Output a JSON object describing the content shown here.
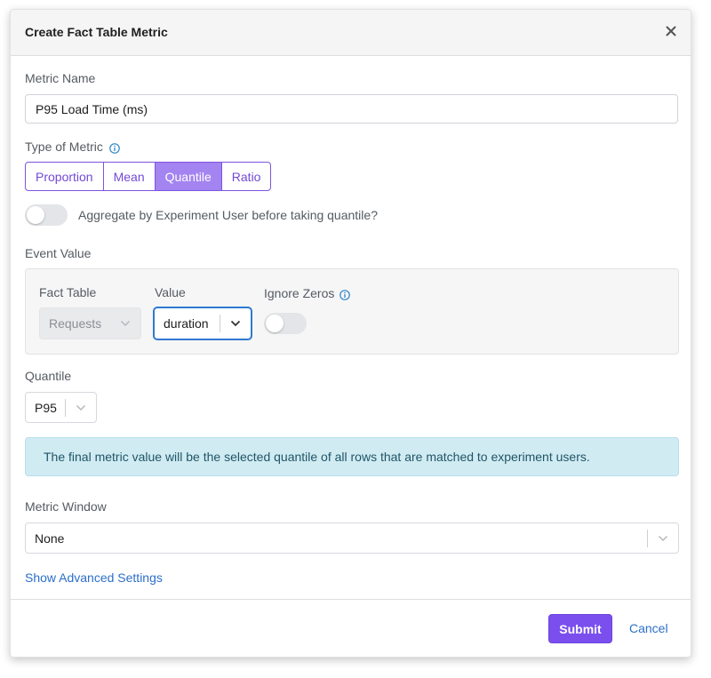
{
  "modal": {
    "title": "Create Fact Table Metric",
    "close_icon": "close-icon"
  },
  "metric_name": {
    "label": "Metric Name",
    "value": "P95 Load Time (ms)"
  },
  "metric_type": {
    "label": "Type of Metric",
    "info_icon": "info-icon",
    "options": [
      "Proportion",
      "Mean",
      "Quantile",
      "Ratio"
    ],
    "selected": "Quantile"
  },
  "aggregate_toggle": {
    "label": "Aggregate by Experiment User before taking quantile?",
    "enabled": false
  },
  "event_value": {
    "label": "Event Value",
    "fact_table": {
      "label": "Fact Table",
      "value": "Requests",
      "disabled": true
    },
    "value_column": {
      "label": "Value",
      "value": "duration"
    },
    "ignore_zeros": {
      "label": "Ignore Zeros",
      "info_icon": "info-icon",
      "enabled": false
    }
  },
  "quantile": {
    "label": "Quantile",
    "value": "P95"
  },
  "info_alert": {
    "text": "The final metric value will be the selected quantile of all rows that are matched to experiment users."
  },
  "metric_window": {
    "label": "Metric Window",
    "value": "None"
  },
  "advanced_link": "Show Advanced Settings",
  "footer": {
    "submit_label": "Submit",
    "cancel_label": "Cancel"
  },
  "colors": {
    "accent": "#7b4fee",
    "segment_active": "#a384f0",
    "link": "#2c6fca",
    "info_bg": "#d1ebf3"
  }
}
